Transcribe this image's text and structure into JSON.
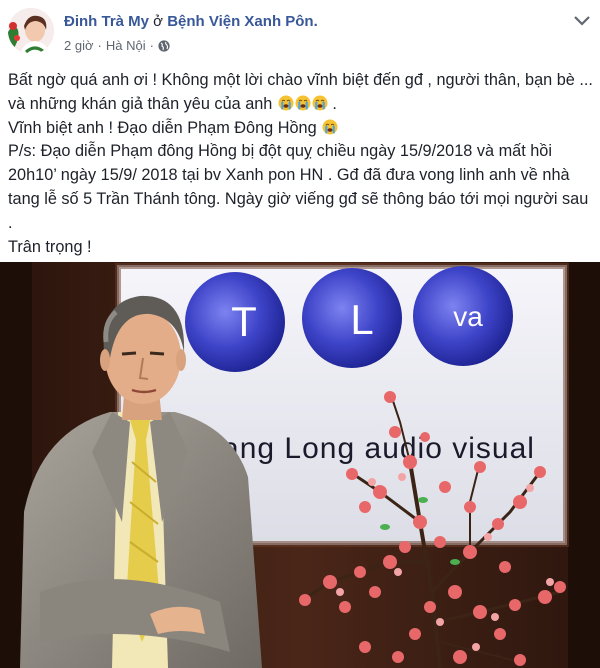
{
  "post": {
    "author": "Đinh Trà My",
    "at": " ở ",
    "place": "Bệnh Viện Xanh Pôn.",
    "time": "2 giờ",
    "separator": "·",
    "location": "Hà Nội",
    "privacy_icon": "globe-icon",
    "menu_icon": "chevron-down-icon"
  },
  "content": {
    "line1": "Bất ngờ quá anh ơi ! Không một lời chào vĩnh biệt đến gđ , người thân, bạn bè ... và những khán giả thân yêu của anh",
    "line1_end": " .",
    "line2": "Vĩnh biệt anh ! Đạo diễn Phạm Đông Hồng",
    "line3": "P/s: Đạo diễn Phạm đông Hồng bị đột quỵ chiều ngày 15/9/2018 và mất hồi 20h10’ ngày 15/9/ 2018 tại bv Xanh pon HN . Gđ đã đưa vong linh anh về nhà tang lễ số 5 Trần Thánh tông. Ngày giờ viếng gđ sẽ thông báo tới mọi người sau .",
    "line4": "Trân trọng !",
    "emoji_icon": "loudly-crying-face-icon"
  },
  "photo": {
    "logo_letters": [
      "T",
      "L",
      "va"
    ],
    "logo_text": "Thang Long audio visual"
  },
  "colors": {
    "link": "#385898",
    "text": "#1d2129",
    "meta": "#606770",
    "banner_circle": "#3e44c8",
    "blossom": "#e8686a"
  }
}
